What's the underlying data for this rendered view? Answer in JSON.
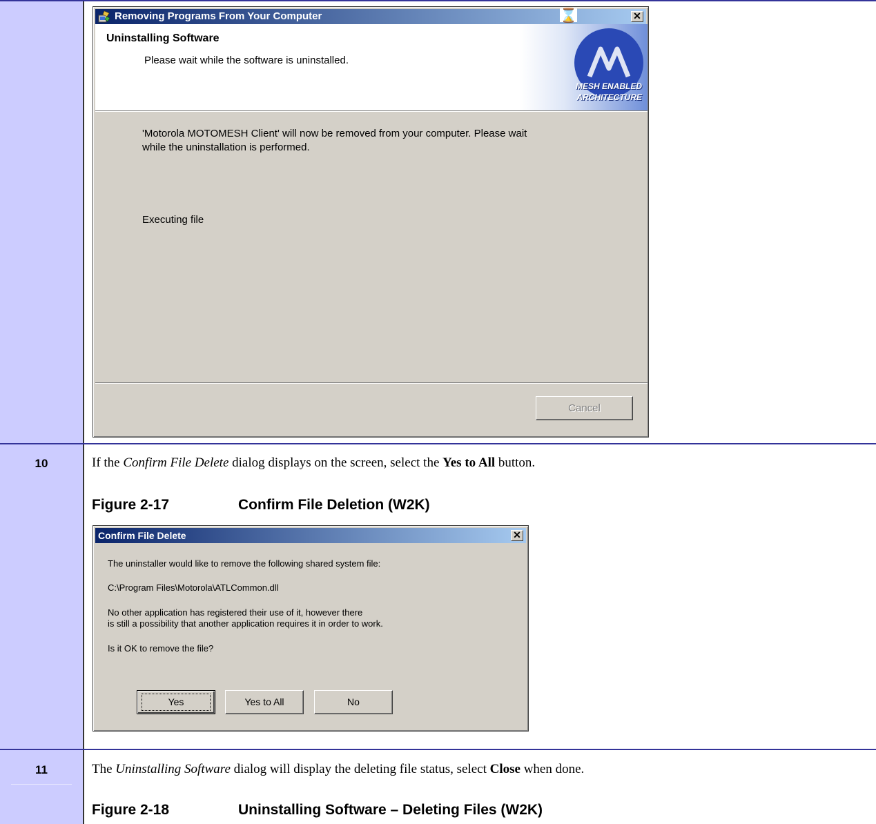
{
  "steps": [
    {
      "number": "10",
      "text_prefix": "If the ",
      "text_em": "Confirm File Delete",
      "text_mid": " dialog displays on the screen, select the ",
      "text_bold": "Yes to All",
      "text_suffix": " button.",
      "figure_number": "Figure 2-17",
      "figure_title": "Confirm File Deletion (W2K)"
    },
    {
      "number": "11",
      "text_prefix": "The ",
      "text_em": "Uninstalling Software",
      "text_mid": " dialog will display the deleting file status, select ",
      "text_bold": "Close",
      "text_suffix": " when done.",
      "figure_number": "Figure 2-18",
      "figure_title": "Uninstalling Software – Deleting Files (W2K)"
    }
  ],
  "dialog_uninstall": {
    "title": "Removing Programs From Your Computer",
    "heading": "Uninstalling Software",
    "subheading": "Please wait while the software is uninstalled.",
    "banner_line1": "MESH ENABLED",
    "banner_line2": "ARCHITECTURE",
    "body_line1": "'Motorola MOTOMESH Client' will now be removed from your computer. Please wait",
    "body_line2": "while the uninstallation is performed.",
    "status": "Executing file",
    "cancel_label": "Cancel",
    "close_glyph": "✕",
    "cursor_glyph": "⌛"
  },
  "dialog_confirm": {
    "title": "Confirm File Delete",
    "line1": "The uninstaller would like to remove the following shared system file:",
    "path": "C:\\Program Files\\Motorola\\ATLCommon.dll",
    "line3a": "No other application has registered their use of it, however there",
    "line3b": "is still a possibility that another application requires it in order to work.",
    "question": "Is it OK to remove the file?",
    "yes_label": "Yes",
    "yes_all_label": "Yes to All",
    "no_label": "No",
    "close_glyph": "✕"
  },
  "colors": {
    "left_column": "#ccccff",
    "row_rule": "#333399",
    "dialog_face": "#d4d0c8",
    "titlebar_start": "#0a246a",
    "titlebar_end": "#a6caf0"
  }
}
